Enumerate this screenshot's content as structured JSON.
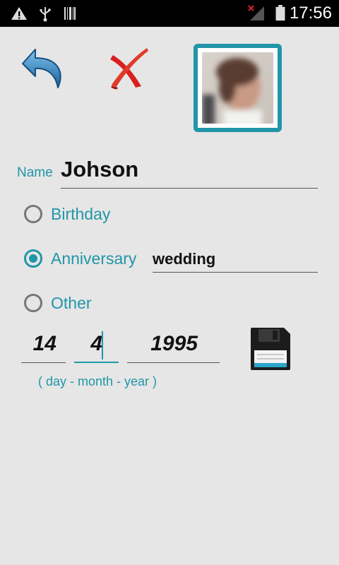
{
  "status_bar": {
    "time": "17:56",
    "icons": [
      "warning-icon",
      "usb-icon",
      "barcode-icon",
      "no-signal-icon",
      "battery-icon"
    ]
  },
  "toolbar": {
    "back_icon": "undo-arrow-icon",
    "cancel_icon": "red-x-icon",
    "photo": "contact-photo"
  },
  "form": {
    "name_label": "Name",
    "name_value": "Johson",
    "options": [
      {
        "label": "Birthday",
        "checked": false
      },
      {
        "label": "Anniversary",
        "checked": true
      },
      {
        "label": "Other",
        "checked": false
      }
    ],
    "occasion_value": "wedding",
    "day": "14",
    "month": "4",
    "year": "1995",
    "date_hint": "( day - month - year )",
    "save_icon": "floppy-disk-icon"
  },
  "colors": {
    "accent": "#2196a8",
    "background": "#e6e6e6",
    "statusbar": "#000000",
    "cancel": "#d92020",
    "back_arrow": "#1f78c1"
  }
}
